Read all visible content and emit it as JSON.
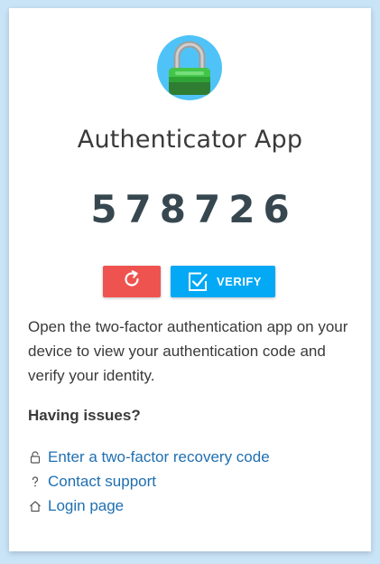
{
  "app": {
    "title": "Authenticator App",
    "code": "578726"
  },
  "actions": {
    "refresh_icon": "refresh-icon",
    "verify_label": "VERIFY",
    "verify_icon": "checkbox-icon",
    "refresh_color": "#ef5350",
    "verify_color": "#03a9f4"
  },
  "description": "Open the two-factor authentication app on your device to view your authentication code and verify your identity.",
  "help": {
    "heading": "Having issues?",
    "links": [
      {
        "icon": "lock-icon",
        "label": "Enter a two-factor recovery code"
      },
      {
        "icon": "question-icon",
        "label": "Contact support"
      },
      {
        "icon": "home-icon",
        "label": "Login page"
      }
    ]
  },
  "colors": {
    "link": "#1f6fb2",
    "background": "#c9e3f7"
  }
}
